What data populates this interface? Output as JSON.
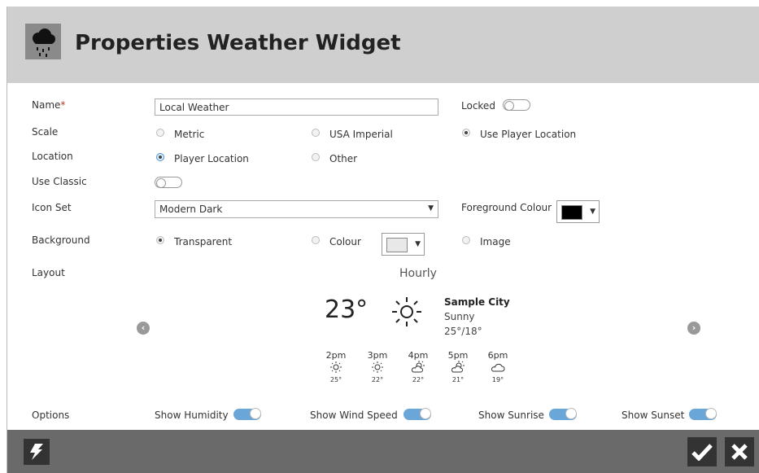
{
  "header": {
    "title": "Properties Weather Widget",
    "icon": "cloud-rain-icon"
  },
  "form": {
    "name": {
      "label": "Name",
      "required_mark": "*",
      "value": "Local Weather"
    },
    "locked": {
      "label": "Locked",
      "on": false
    },
    "scale": {
      "label": "Scale",
      "options": [
        "Metric",
        "USA Imperial",
        "Use Player Location"
      ],
      "selected": "Use Player Location"
    },
    "location": {
      "label": "Location",
      "options": [
        "Player Location",
        "Other"
      ],
      "selected": "Player Location"
    },
    "use_classic": {
      "label": "Use Classic",
      "on": false
    },
    "icon_set": {
      "label": "Icon Set",
      "value": "Modern Dark"
    },
    "foreground": {
      "label": "Foreground Colour",
      "color": "#000000"
    },
    "background": {
      "label": "Background",
      "options": [
        "Transparent",
        "Colour",
        "Image"
      ],
      "selected": "Transparent",
      "color": "#e8e8e8"
    },
    "layout": {
      "label": "Layout",
      "name": "Hourly"
    }
  },
  "preview": {
    "temp": "23°",
    "city": "Sample City",
    "condition": "Sunny",
    "range": "25°/18°",
    "hours": [
      {
        "time": "2pm",
        "icon": "sun-icon",
        "temp": "25°"
      },
      {
        "time": "3pm",
        "icon": "sun-icon",
        "temp": "22°"
      },
      {
        "time": "4pm",
        "icon": "partly-cloudy-icon",
        "temp": "22°"
      },
      {
        "time": "5pm",
        "icon": "partly-cloudy-icon",
        "temp": "21°"
      },
      {
        "time": "6pm",
        "icon": "cloud-icon",
        "temp": "19°"
      }
    ]
  },
  "options": {
    "label": "Options",
    "show_humidity": "Show Humidity",
    "show_wind_speed": "Show Wind Speed",
    "show_sunrise": "Show Sunrise",
    "show_sunset": "Show Sunset"
  },
  "colors": {
    "header_bg": "#cfcfcf",
    "footer_bg": "#6a6a6a",
    "toggle_on": "#6aa6d8"
  }
}
